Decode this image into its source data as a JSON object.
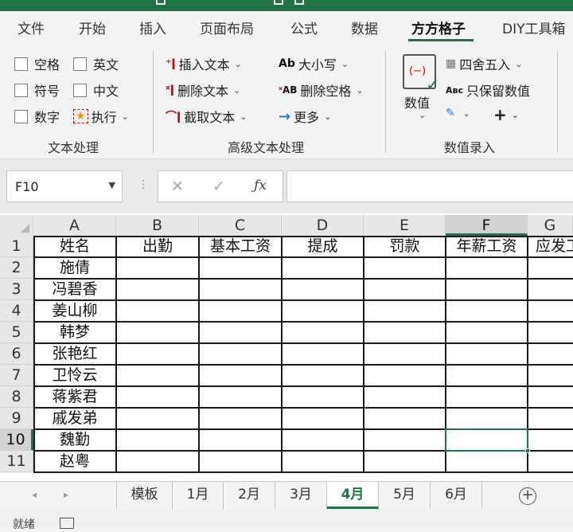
{
  "ribbon_tabs": [
    "文件",
    "开始",
    "插入",
    "页面布局",
    "公式",
    "数据",
    "方方格子",
    "DIY工具箱"
  ],
  "active_tab": "方方格子",
  "text_group": {
    "items": [
      "空格",
      "英文",
      "符号",
      "中文",
      "数字",
      "执行"
    ],
    "label": "文本处理"
  },
  "adv_group": {
    "items": [
      "插入文本",
      "删除文本",
      "截取文本",
      "大小写",
      "删除空格",
      "更多"
    ],
    "label": "高级文本处理"
  },
  "num_group": {
    "big_button": "数值",
    "items": [
      "四舍五入",
      "只保留数值"
    ],
    "label": "数值录入"
  },
  "name_box": "F10",
  "col_headers": [
    "A",
    "B",
    "C",
    "D",
    "E",
    "F",
    "G"
  ],
  "selected_col": "F",
  "row_numbers": [
    "1",
    "2",
    "3",
    "4",
    "5",
    "6",
    "7",
    "8",
    "9",
    "10",
    "11"
  ],
  "selected_row": "10",
  "header_row": [
    "姓名",
    "出勤",
    "基本工资",
    "提成",
    "罚款",
    "年薪工资",
    "应发工"
  ],
  "names": [
    "施倩",
    "冯碧香",
    "姜山柳",
    "韩梦",
    "张艳红",
    "卫怜云",
    "蒋紫君",
    "戚发弟",
    "魏勤",
    "赵粤"
  ],
  "sheet_tabs": [
    "模板",
    "1月",
    "2月",
    "3月",
    "4月",
    "5月",
    "6月"
  ],
  "active_sheet": "4月",
  "status": "就绪",
  "accent_color": "#217346"
}
